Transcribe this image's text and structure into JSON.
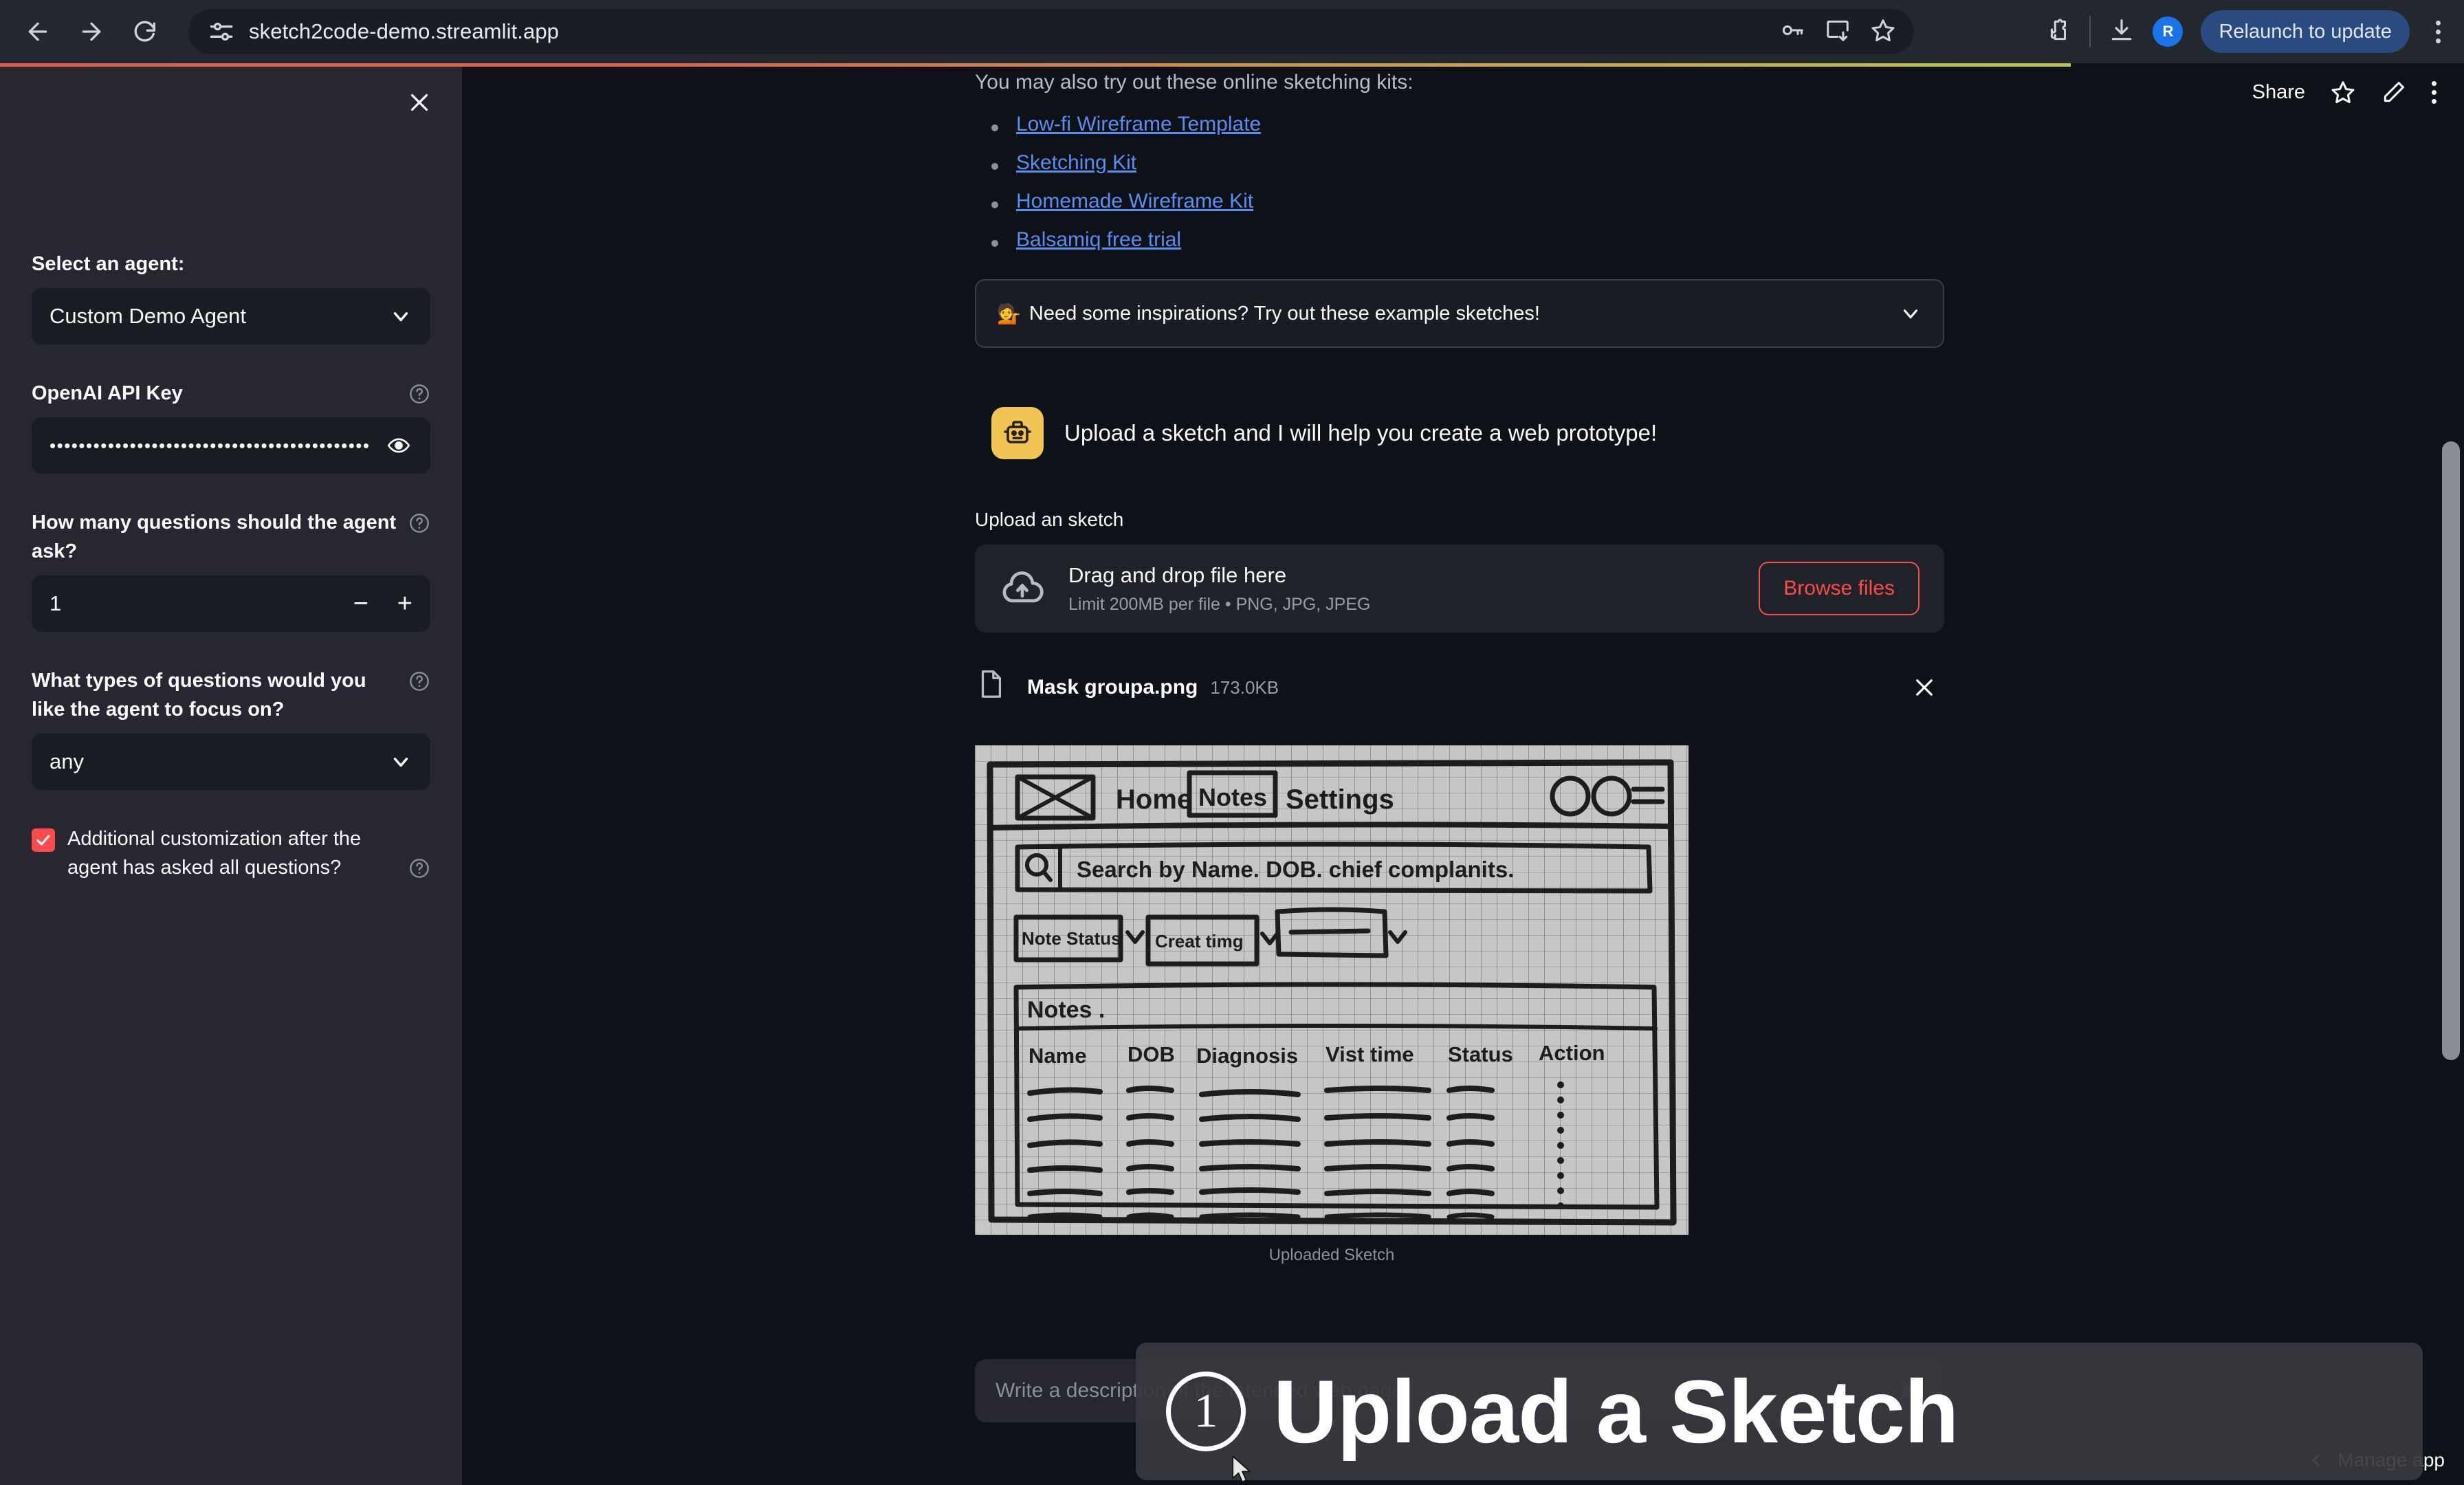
{
  "browser": {
    "url": "sketch2code-demo.streamlit.app",
    "back_icon": "back-arrow-icon",
    "forward_icon": "forward-arrow-icon",
    "reload_icon": "reload-icon",
    "site_info_icon": "site-settings-icon",
    "password_icon": "key-icon",
    "install_icon": "install-app-icon",
    "bookmark_icon": "star-icon",
    "extensions_icon": "extensions-puzzle-icon",
    "downloads_icon": "downloads-icon",
    "profile_initial": "R",
    "relaunch_label": "Relaunch to update",
    "menu_icon": "kebab-menu-icon"
  },
  "sidebar": {
    "close_icon": "close-icon",
    "agent": {
      "label": "Select an agent:",
      "value": "Custom Demo Agent",
      "chevron_icon": "chevron-down-icon"
    },
    "api_key": {
      "label": "OpenAI API Key",
      "value": "••••••••••••••••••••••••••••••••••••••••••••",
      "reveal_icon": "eye-icon",
      "help_icon": "help-circle-icon"
    },
    "question_count": {
      "label": "How many questions should the agent ask?",
      "value": "1",
      "decrement_label": "−",
      "increment_label": "+",
      "help_icon": "help-circle-icon"
    },
    "question_types": {
      "label": "What types of questions would you like the agent to focus on?",
      "value": "any",
      "chevron_icon": "chevron-down-icon",
      "help_icon": "help-circle-icon"
    },
    "additional_customization": {
      "label": "Additional customization after the agent has asked all questions?",
      "checked": true,
      "accent_color": "#ff4b4b",
      "help_icon": "help-circle-icon"
    }
  },
  "app_toolbar": {
    "share_label": "Share",
    "favorite_icon": "star-icon",
    "edit_icon": "pencil-icon",
    "menu_icon": "kebab-menu-icon"
  },
  "main": {
    "intro_text": "You may also try out these online sketching kits:",
    "kit_links": [
      "Low-fi Wireframe Template",
      "Sketching Kit",
      "Homemade Wireframe Kit",
      "Balsamiq free trial"
    ],
    "link_color": "#5b8dee",
    "expander": {
      "emoji": "💁",
      "label": "Need some inspirations? Try out these example sketches!",
      "chevron_icon": "chevron-down-icon",
      "expanded": false
    },
    "assistant_message": {
      "avatar_icon": "robot-icon",
      "avatar_color": "#f1c453",
      "text": "Upload a sketch and I will help you create a web prototype!"
    },
    "uploader": {
      "label": "Upload an sketch",
      "cloud_icon": "cloud-upload-icon",
      "drop_title": "Drag and drop file here",
      "drop_subtitle": "Limit 200MB per file • PNG, JPG, JPEG",
      "browse_label": "Browse files",
      "browse_color": "#ff4b4b"
    },
    "uploaded_file": {
      "file_icon": "document-icon",
      "name": "Mask groupa.png",
      "size": "173.0KB",
      "remove_icon": "close-icon"
    },
    "sketch_caption": "Uploaded Sketch",
    "sketch_content": {
      "nav_items": [
        "Home",
        "Notes",
        "Settings"
      ],
      "active_nav": "Notes",
      "search_placeholder": "Search by Name. DOB. chief complanits.",
      "filters": [
        "Note Status",
        "Creat timg",
        ""
      ],
      "section_title": "Notes .",
      "table_headers": [
        "Name",
        "DOB",
        "Diagnosis",
        "Vist time",
        "Status",
        "Action"
      ],
      "table_rows": 6
    },
    "chat_input": {
      "placeholder": "Write a description of the intended web page.",
      "value": "",
      "send_icon": "send-arrow-icon"
    }
  },
  "footer": {
    "chevron_icon": "chevron-left-icon",
    "manage_app_label": "Manage app"
  },
  "overlay": {
    "step_number": "1",
    "title": "Upload a Sketch"
  }
}
